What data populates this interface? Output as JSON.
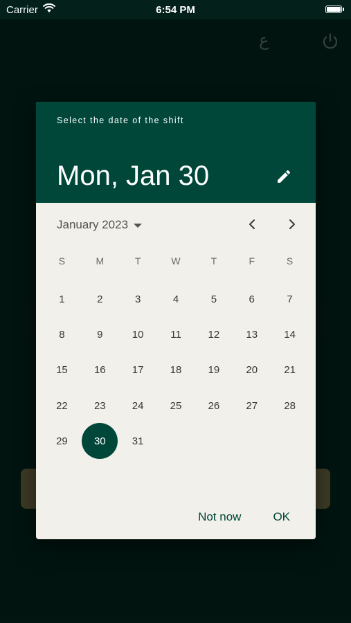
{
  "status_bar": {
    "carrier": "Carrier",
    "time": "6:54 PM"
  },
  "top_bar": {
    "language_toggle": "ع"
  },
  "date_picker": {
    "help_text": "Select the date of the shift",
    "selected_date": "Mon, Jan 30",
    "month_label": "January 2023",
    "weekdays": [
      "S",
      "M",
      "T",
      "W",
      "T",
      "F",
      "S"
    ],
    "first_day_offset": 0,
    "days": [
      "1",
      "2",
      "3",
      "4",
      "5",
      "6",
      "7",
      "8",
      "9",
      "10",
      "11",
      "12",
      "13",
      "14",
      "15",
      "16",
      "17",
      "18",
      "19",
      "20",
      "21",
      "22",
      "23",
      "24",
      "25",
      "26",
      "27",
      "28",
      "29",
      "30",
      "31"
    ],
    "selected_day": "30",
    "actions": {
      "cancel_label": "Not now",
      "confirm_label": "OK"
    }
  },
  "colors": {
    "primary": "#00473a",
    "dialog_background": "#f2f0eb",
    "page_background": "#03201a"
  }
}
